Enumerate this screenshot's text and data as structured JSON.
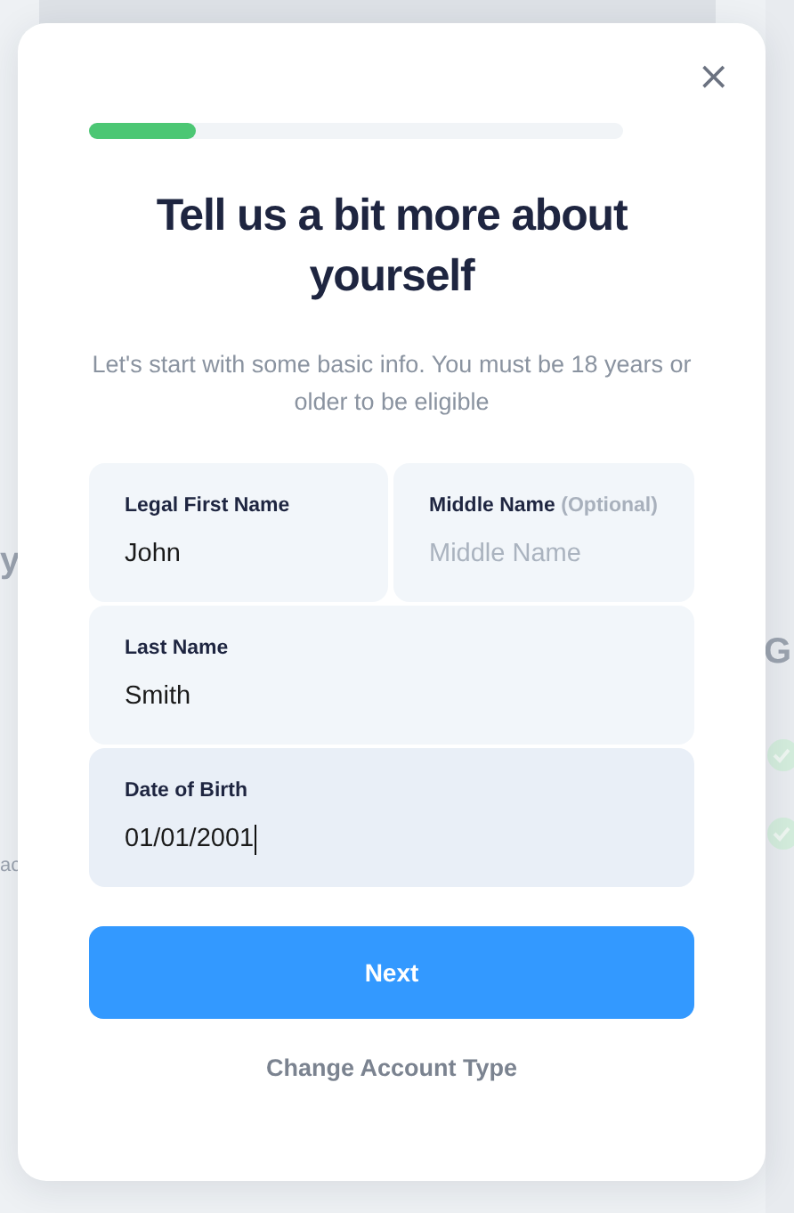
{
  "backdrop": {
    "fragments": [
      "y",
      "G",
      "ac"
    ]
  },
  "dialog": {
    "close": "×",
    "progress": {
      "level": 0.2
    },
    "title": "Tell us a bit more about yourself",
    "subtitle": "Let's start with some basic info. You must be 18 years or older to be eligible",
    "fields": [
      {
        "label": "Legal First Name",
        "value": "John",
        "focused": false
      },
      {
        "label": "Middle Name",
        "note": "(Optional)",
        "placeholder": "Middle Name",
        "focused": false
      },
      {
        "label": "Last Name",
        "value": "Smith",
        "focused": false
      },
      {
        "label": "Date of Birth",
        "value": "01/01/2001",
        "focused": true
      }
    ],
    "primary_button": "Next",
    "link": "Change Account Type"
  }
}
